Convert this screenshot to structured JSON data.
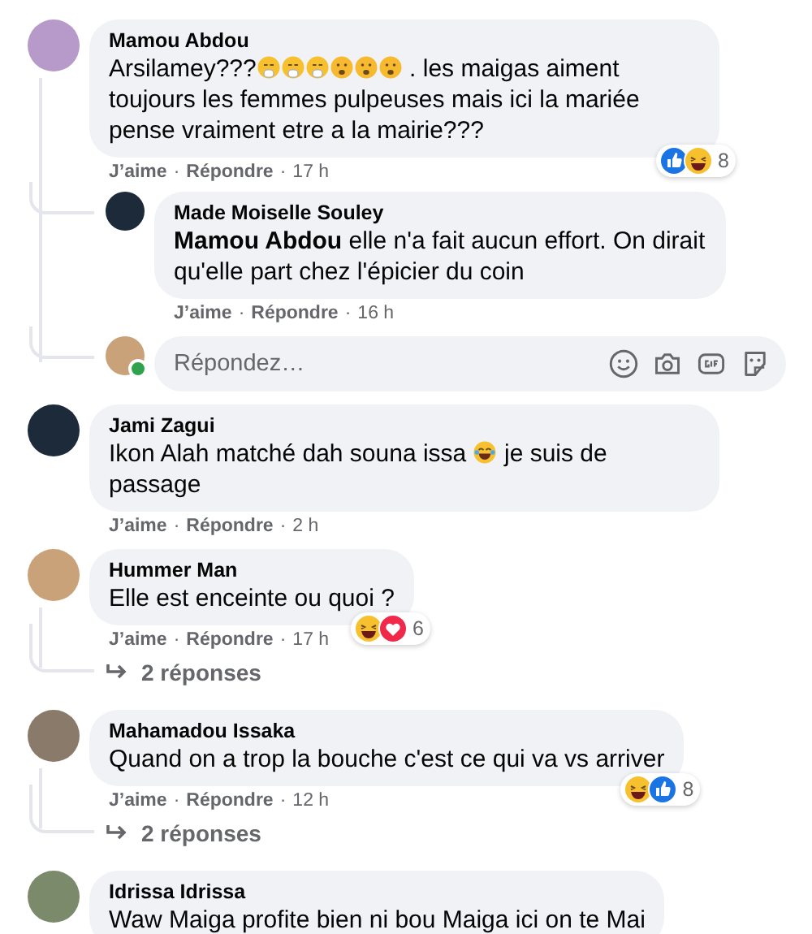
{
  "separator": "·",
  "comments": [
    {
      "author": "Mamou Abdou",
      "body": [
        {
          "kind": "text",
          "text": "Arsilamey???"
        },
        {
          "kind": "sneeze"
        },
        {
          "kind": "sneeze"
        },
        {
          "kind": "sneeze"
        },
        {
          "kind": "frown"
        },
        {
          "kind": "frown"
        },
        {
          "kind": "frown"
        },
        {
          "kind": "text",
          "text": " . les maigas aiment toujours les femmes pulpeuses mais ici la mariée pense vraiment etre a la mairie???"
        }
      ],
      "like": "J’aime",
      "reply": "Répondre",
      "time": "17 h",
      "reactions": [
        {
          "kind": "like"
        },
        {
          "kind": "haha"
        }
      ],
      "reaction_count": "8",
      "replies": [
        {
          "author": "Made Moiselle Souley",
          "body": [
            {
              "kind": "text",
              "text": "**Mamou Abdou** elle n'a fait aucun effort. On dirait qu'elle part chez l'épicier du coin"
            }
          ],
          "like": "J’aime",
          "reply": "Répondre",
          "time": "16 h"
        }
      ],
      "reply_box": {
        "placeholder": "Répondez…",
        "online": true
      }
    },
    {
      "author": "Jami Zagui",
      "body": [
        {
          "kind": "text",
          "text": "Ikon Alah matché dah souna issa "
        },
        {
          "kind": "tears"
        },
        {
          "kind": "text",
          "text": " je suis de passage"
        }
      ],
      "like": "J’aime",
      "reply": "Répondre",
      "time": "2 h"
    },
    {
      "author": "Hummer Man",
      "body": [
        {
          "kind": "text",
          "text": "Elle est enceinte ou quoi ?"
        }
      ],
      "like": "J’aime",
      "reply": "Répondre",
      "time": "17 h",
      "reactions": [
        {
          "kind": "haha"
        },
        {
          "kind": "love"
        }
      ],
      "reaction_count": "6",
      "more_replies": "2 réponses"
    },
    {
      "author": "Mahamadou Issaka",
      "body": [
        {
          "kind": "text",
          "text": "Quand on a trop la bouche c'est ce qui va vs arriver"
        }
      ],
      "like": "J’aime",
      "reply": "Répondre",
      "time": "12 h",
      "reactions": [
        {
          "kind": "haha"
        },
        {
          "kind": "like"
        }
      ],
      "reaction_count": "8",
      "more_replies": "2 réponses"
    },
    {
      "author": "Idrissa Idrissa",
      "body": [
        {
          "kind": "text",
          "text": "Waw Maiga profite bien ni bou Maiga ici on te Mai"
        }
      ]
    }
  ]
}
